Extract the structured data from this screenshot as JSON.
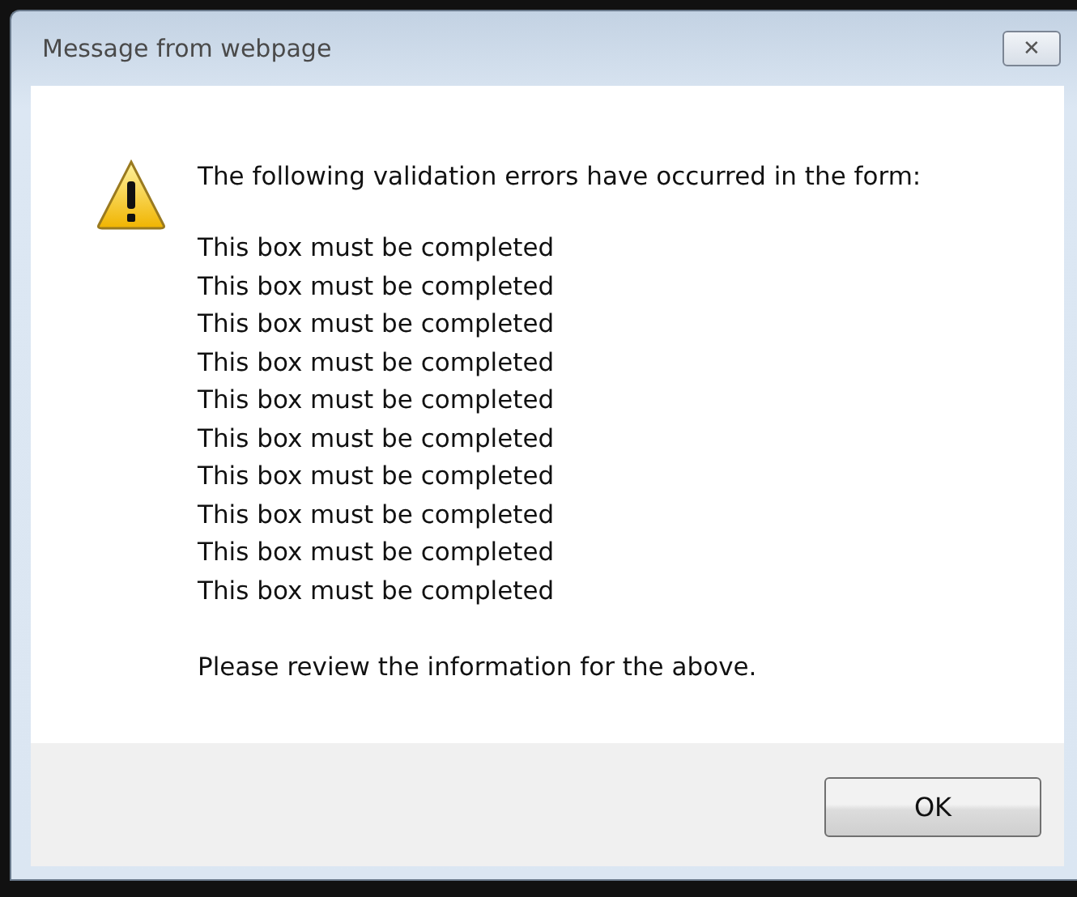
{
  "window": {
    "title": "Message from webpage",
    "close": "✕"
  },
  "message": {
    "heading": "The following validation errors have occurred in the form:",
    "errors": [
      "This box must be completed",
      "This box must be completed",
      "This box must be completed",
      "This box must be completed",
      "This box must be completed",
      "This box must be completed",
      "This box must be completed",
      "This box must be completed",
      "This box must be completed",
      "This box must be completed"
    ],
    "footer": "Please review the information for the above."
  },
  "buttons": [
    "OK"
  ]
}
